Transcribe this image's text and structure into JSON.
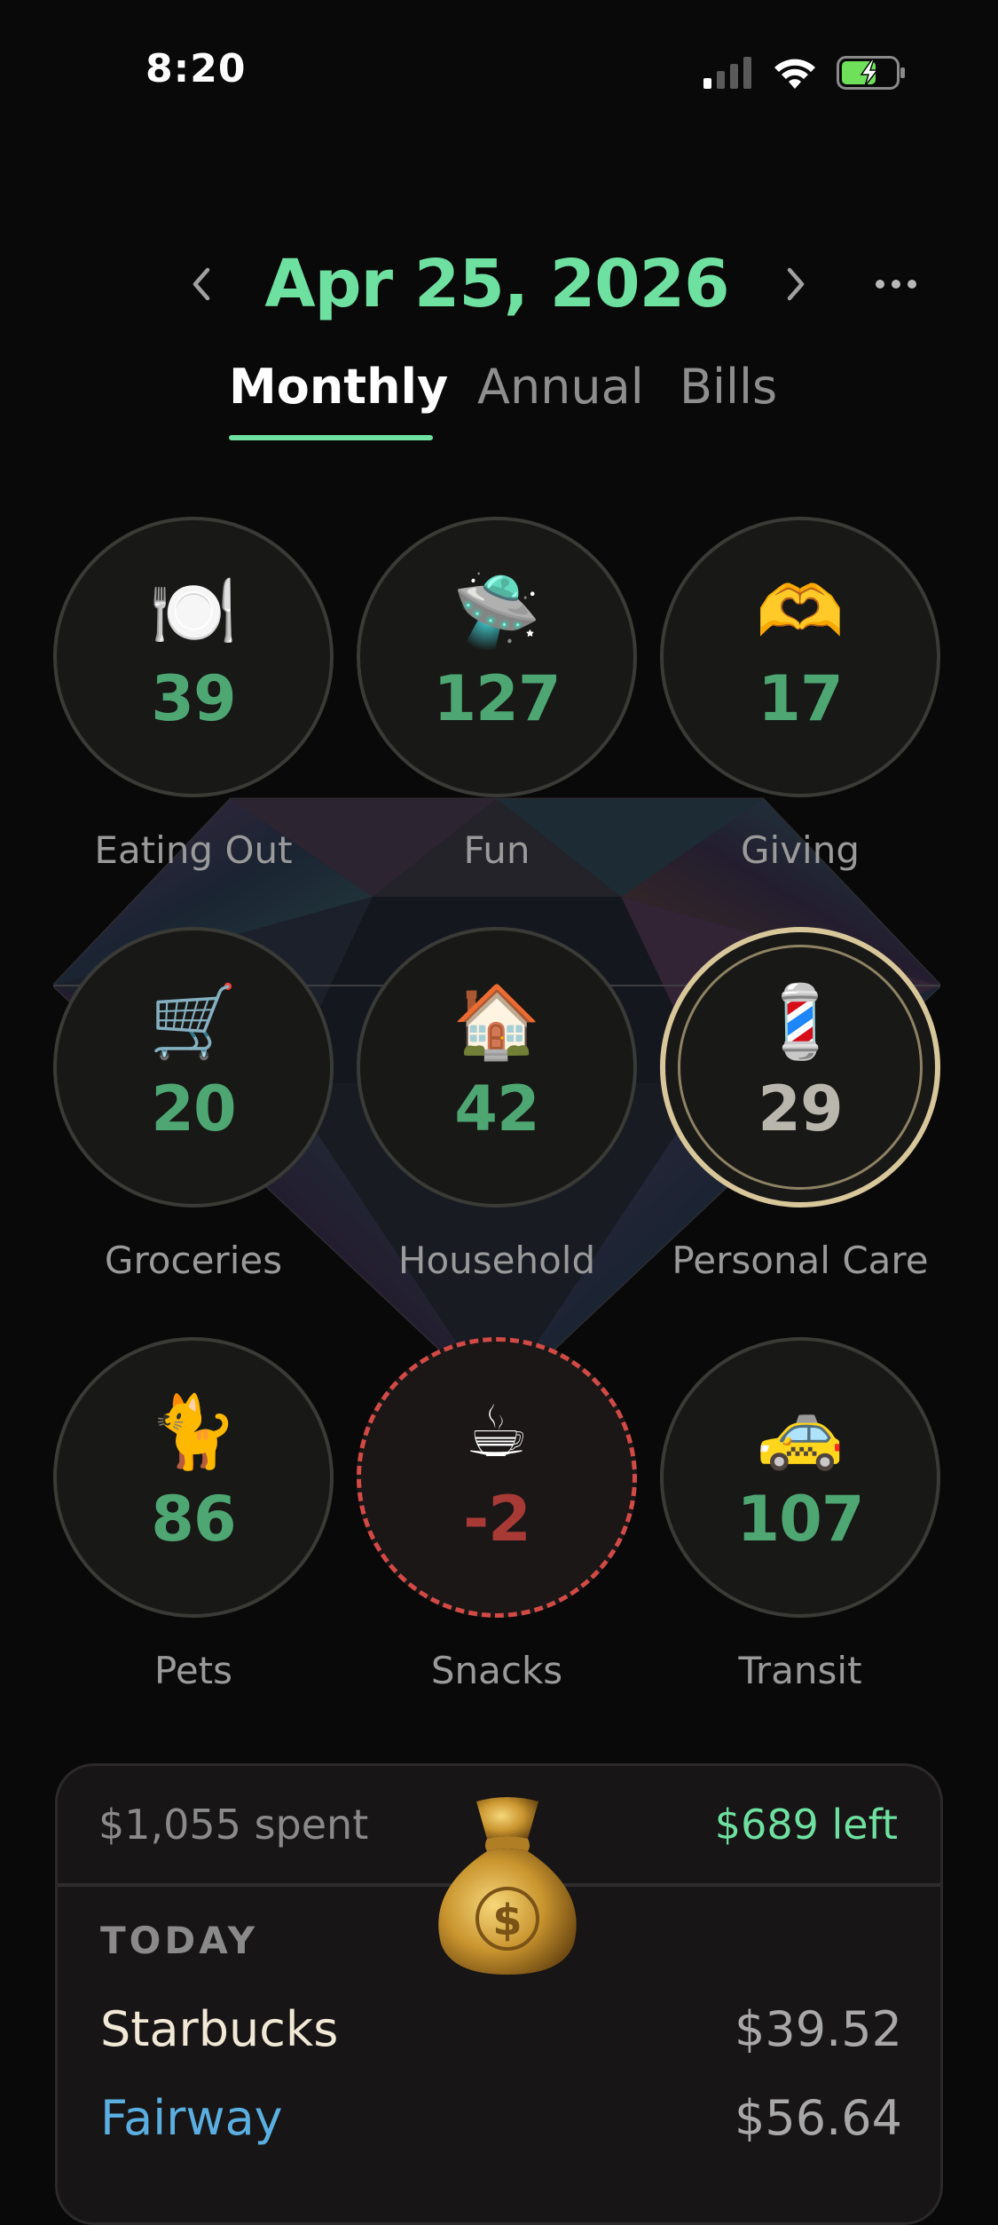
{
  "status_bar": {
    "time": "8:20",
    "icons": [
      "cellular-signal-icon",
      "wifi-icon",
      "battery-charging-icon"
    ]
  },
  "header": {
    "date": "Apr 25, 2026",
    "prev_icon": "chevron-left-icon",
    "next_icon": "chevron-right-icon",
    "more_icon": "ellipsis-icon"
  },
  "tabs": [
    {
      "label": "Monthly",
      "active": true
    },
    {
      "label": "Annual",
      "active": false
    },
    {
      "label": "Bills",
      "active": false
    }
  ],
  "categories": [
    {
      "label": "Eating Out",
      "value": "39",
      "icon": "🍽️",
      "icon_name": "plate-cutlery-icon",
      "state": "normal"
    },
    {
      "label": "Fun",
      "value": "127",
      "icon": "🛸",
      "icon_name": "flying-saucer-icon",
      "state": "normal"
    },
    {
      "label": "Giving",
      "value": "17",
      "icon": "🫶",
      "icon_name": "heart-hands-icon",
      "state": "normal"
    },
    {
      "label": "Groceries",
      "value": "20",
      "icon": "🛒",
      "icon_name": "shopping-cart-icon",
      "state": "normal"
    },
    {
      "label": "Household",
      "value": "42",
      "icon": "🏠",
      "icon_name": "house-icon",
      "state": "normal"
    },
    {
      "label": "Personal Care",
      "value": "29",
      "icon": "💈",
      "icon_name": "barber-pole-icon",
      "state": "selected"
    },
    {
      "label": "Pets",
      "value": "86",
      "icon": "🐈",
      "icon_name": "cat-icon",
      "state": "normal"
    },
    {
      "label": "Snacks",
      "value": "-2",
      "icon": "☕",
      "icon_name": "coffee-cup-icon",
      "state": "over"
    },
    {
      "label": "Transit",
      "value": "107",
      "icon": "🚕",
      "icon_name": "taxi-icon",
      "state": "normal"
    }
  ],
  "summary": {
    "spent": "$1,055 spent",
    "left": "$689 left",
    "bag_icon": "money-bag-icon",
    "section": "TODAY",
    "transactions": [
      {
        "name": "Starbucks",
        "amount": "$39.52"
      },
      {
        "name": "Fairway",
        "amount": "$56.64"
      }
    ]
  },
  "colors": {
    "accent": "#6ee0a0",
    "value_green": "#4ea672",
    "negative": "#d24a46",
    "selected_ring": "#d8c79a",
    "background": "#090909"
  }
}
